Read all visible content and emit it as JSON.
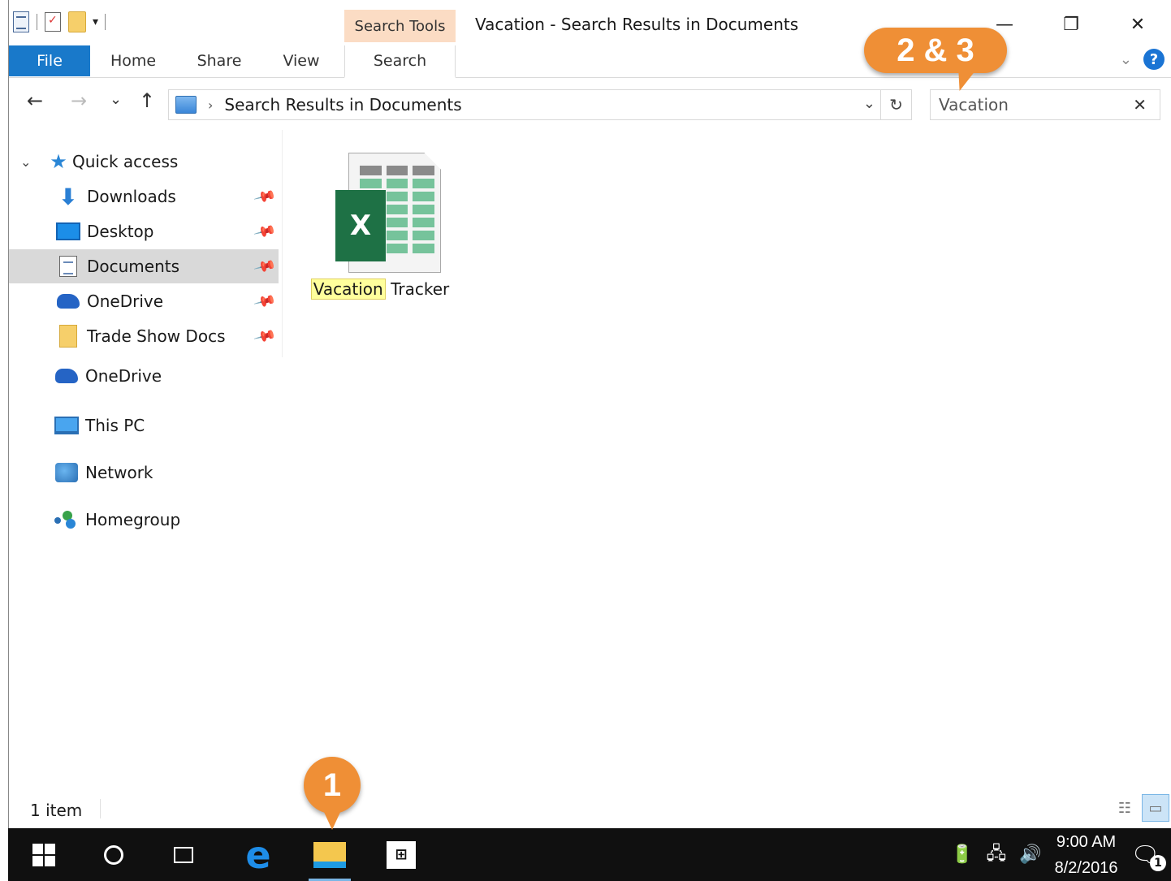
{
  "window": {
    "title": "Vacation - Search Results in Documents",
    "contextual_tab": "Search Tools",
    "controls": {
      "minimize": "—",
      "restore": "❐",
      "close": "✕"
    }
  },
  "ribbon": {
    "tabs": [
      "File",
      "Home",
      "Share",
      "View",
      "Search"
    ],
    "active_tab": "Search",
    "expand_icon": "chevron-down",
    "help_label": "?"
  },
  "address": {
    "back": "←",
    "forward": "→",
    "recent": "⌄",
    "up": "↑",
    "separator": "›",
    "path": "Search Results in Documents",
    "dropdown": "⌄",
    "refresh": "↻"
  },
  "search": {
    "value": "Vacation",
    "clear": "✕"
  },
  "nav": {
    "quick_access": "Quick access",
    "pinned": [
      {
        "label": "Downloads",
        "icon": "download-icon"
      },
      {
        "label": "Desktop",
        "icon": "desktop-icon"
      },
      {
        "label": "Documents",
        "icon": "documents-icon",
        "selected": true
      },
      {
        "label": "OneDrive",
        "icon": "onedrive-icon"
      },
      {
        "label": "Trade Show Docs",
        "icon": "folder-icon"
      }
    ],
    "roots": [
      {
        "label": "OneDrive",
        "icon": "onedrive-icon"
      },
      {
        "label": "This PC",
        "icon": "pc-icon"
      },
      {
        "label": "Network",
        "icon": "network-icon"
      },
      {
        "label": "Homegroup",
        "icon": "homegroup-icon"
      }
    ]
  },
  "content": {
    "files": [
      {
        "name_match": "Vacation",
        "name_rest": " Tracker",
        "icon": "excel-file-icon",
        "badge": "X"
      }
    ]
  },
  "status": {
    "count": "1 item"
  },
  "taskbar": {
    "time": "9:00 AM",
    "date": "8/2/2016",
    "notifications": "1"
  },
  "callouts": {
    "top": "2 & 3",
    "bottom": "1"
  },
  "colors": {
    "accent": "#1979ca",
    "contextual_tab": "#fbdcc4",
    "callout": "#ef8f36",
    "excel": "#1e7145",
    "taskbar": "#101010"
  }
}
